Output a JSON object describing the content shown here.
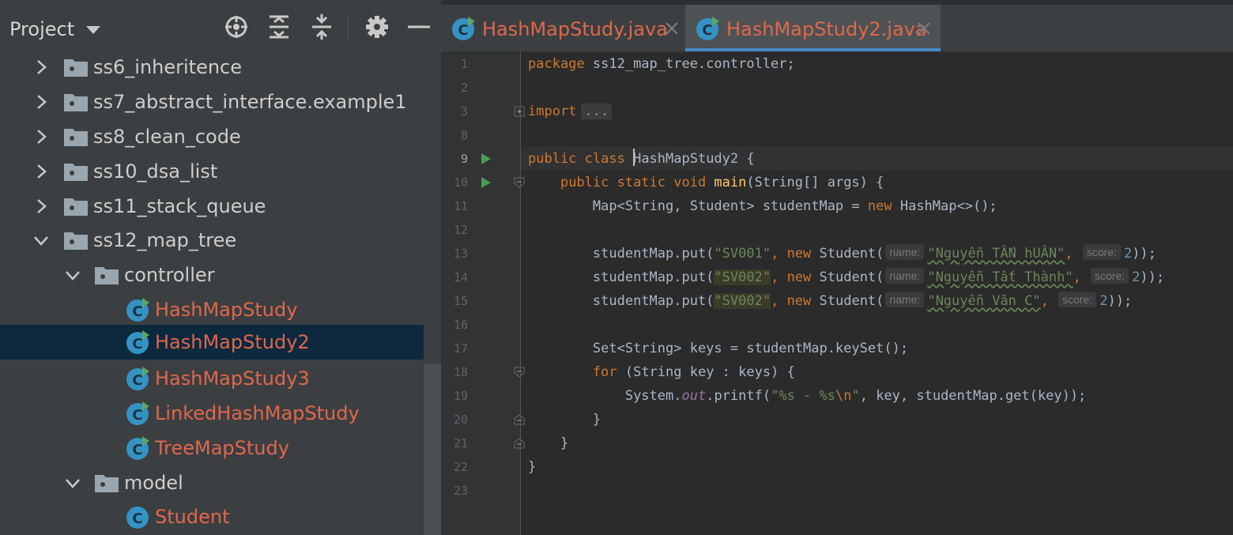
{
  "project_panel": {
    "title": "Project",
    "icons": [
      "dropdown-icon",
      "locate-icon",
      "expand-all-icon",
      "collapse-all-icon",
      "gear-icon",
      "hide-icon"
    ],
    "tree": [
      {
        "label": "ss6_inheritence",
        "type": "folder",
        "expanded": false
      },
      {
        "label": "ss7_abstract_interface.example1",
        "type": "folder",
        "expanded": false
      },
      {
        "label": "ss8_clean_code",
        "type": "folder",
        "expanded": false
      },
      {
        "label": "ss10_dsa_list",
        "type": "folder",
        "expanded": false
      },
      {
        "label": "ss11_stack_queue",
        "type": "folder",
        "expanded": false
      },
      {
        "label": "ss12_map_tree",
        "type": "folder",
        "expanded": true
      },
      {
        "label": "controller",
        "type": "folder",
        "expanded": true
      },
      {
        "label": "HashMapStudy",
        "type": "runnable-class"
      },
      {
        "label": "HashMapStudy2",
        "type": "runnable-class",
        "selected": true
      },
      {
        "label": "HashMapStudy3",
        "type": "runnable-class"
      },
      {
        "label": "LinkedHashMapStudy",
        "type": "runnable-class"
      },
      {
        "label": "TreeMapStudy",
        "type": "runnable-class"
      },
      {
        "label": "model",
        "type": "folder",
        "expanded": true
      },
      {
        "label": "Student",
        "type": "class"
      }
    ]
  },
  "tabs": [
    {
      "label": "HashMapStudy.java",
      "active": false
    },
    {
      "label": "HashMapStudy2.java",
      "active": true
    }
  ],
  "editor": {
    "line_numbers": [
      "1",
      "2",
      "3",
      "8",
      "9",
      "10",
      "11",
      "12",
      "13",
      "14",
      "15",
      "16",
      "17",
      "18",
      "19",
      "20",
      "21",
      "22",
      "23"
    ],
    "code": {
      "l1_kw": "package",
      "l1_rest": " ss12_map_tree.controller;",
      "l3_kw": "import",
      "l3_collapsed": "...",
      "l9_kw": "public class ",
      "l9_h": "H",
      "l9_name": "ashMapStudy2",
      "l9_rest": " {",
      "l10_kw": "public static void ",
      "l10_fn": "main",
      "l10_rest": "(String[] args) {",
      "l11_a": "Map<String, Student> studentMap = ",
      "l11_kw": "new",
      "l11_b": " HashMap<>();",
      "put_prefix": "studentMap.put(",
      "key1": "\"SV001\"",
      "key2": "\"SV002\"",
      "key3": "\"SV002\"",
      "comma": ", ",
      "new_kw": "new",
      "student_call": " Student(",
      "hint_name": "name:",
      "hint_score": "score:",
      "name1": "\"Nguyễn TẤN hUÂN\"",
      "name2": "\"Nguyễn Tất Thành\"",
      "name3": "\"Nguyễn Văn C\"",
      "comma_sep": ", ",
      "score": "2",
      "close": "));",
      "l17": "Set<String> keys = studentMap.keySet();",
      "l18_kw": "for",
      "l18_rest": " (String key : keys) {",
      "l19_a": "System.",
      "l19_out": "out",
      "l19_b": ".printf(",
      "l19_str1": "\"%s - %s",
      "l19_esc": "\\n",
      "l19_str2": "\"",
      "l19_c": ", key, studentMap.get(key));",
      "brace_close": "}"
    }
  },
  "colors": {
    "panel_bg": "#3c3f41",
    "editor_bg": "#2b2b2b",
    "gutter_bg": "#313335",
    "selection": "#0d293e",
    "class_file_red": "#e0674c",
    "tab_accent": "#4a88c7",
    "keyword": "#cc7832",
    "string": "#6a8759",
    "method": "#ffc66d",
    "static_field": "#9876aa",
    "number": "#6897bb",
    "run_green": "#499c54",
    "class_icon": "#3592c4"
  }
}
